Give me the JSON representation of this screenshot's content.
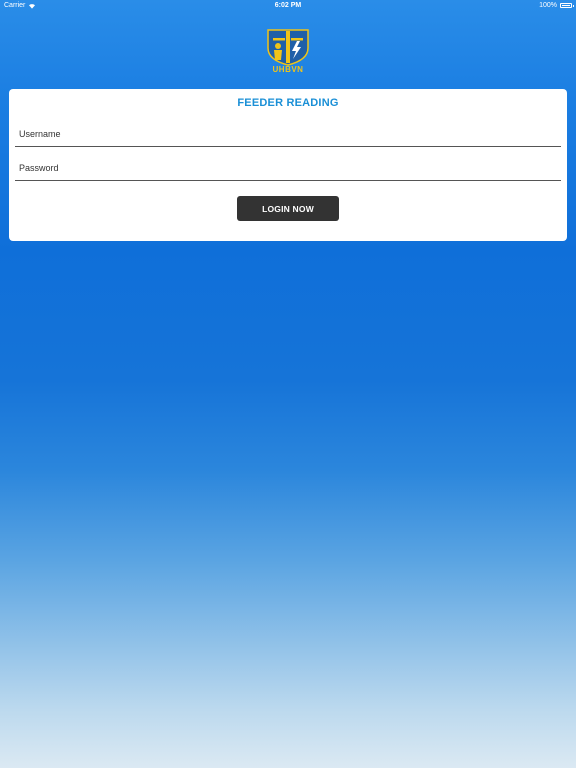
{
  "status_bar": {
    "carrier": "Carrier",
    "time": "6:02 PM",
    "battery": "100%",
    "battery_level": 1.0
  },
  "logo": {
    "text": "UHBVN",
    "colors": {
      "shield": "#1f5fa8",
      "accent": "#f0c419"
    }
  },
  "login": {
    "title": "FEEDER READING",
    "username_placeholder": "Username",
    "password_placeholder": "Password",
    "button_label": "LOGIN NOW"
  },
  "colors": {
    "title": "#1a8fd6",
    "button": "#333333",
    "card": "#ffffff"
  }
}
